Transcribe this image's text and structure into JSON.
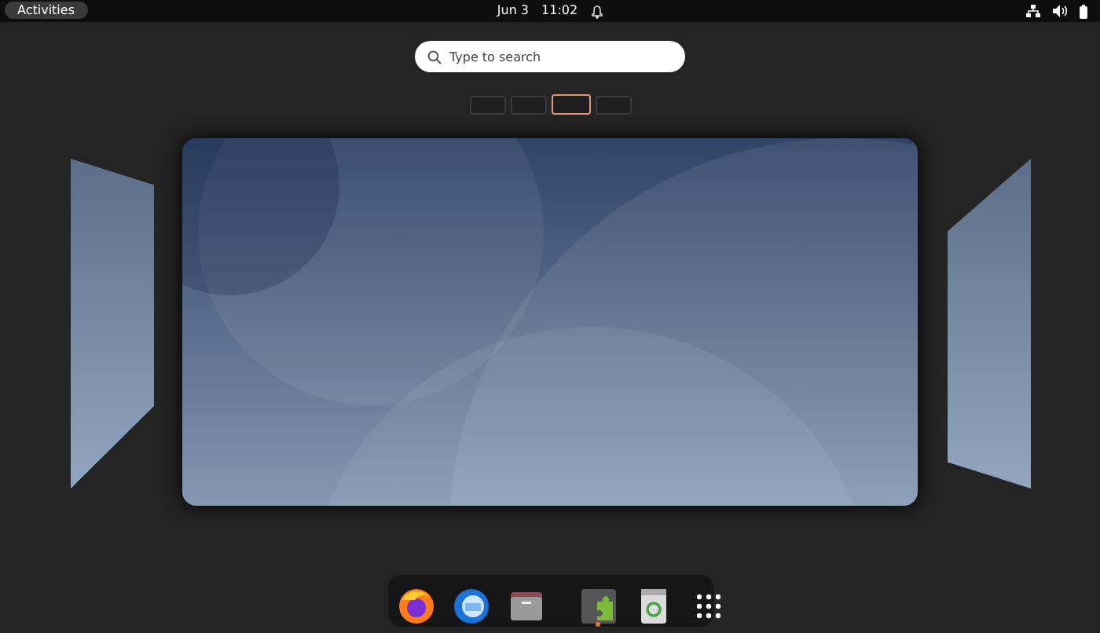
{
  "top_bar": {
    "activities": "Activities",
    "date": "Jun 3",
    "time": "11:02"
  },
  "search": {
    "placeholder": "Type to search"
  },
  "workspaces": [
    {
      "selected": false
    },
    {
      "selected": false
    },
    {
      "selected": true
    },
    {
      "selected": false
    }
  ],
  "dock": [
    {
      "kind": "browser",
      "running": false
    },
    {
      "kind": "mail",
      "running": false
    },
    {
      "kind": "files",
      "running": false
    },
    {
      "kind": "extensions",
      "running": true
    },
    {
      "kind": "trash",
      "running": false
    },
    {
      "kind": "grid",
      "running": false
    }
  ]
}
